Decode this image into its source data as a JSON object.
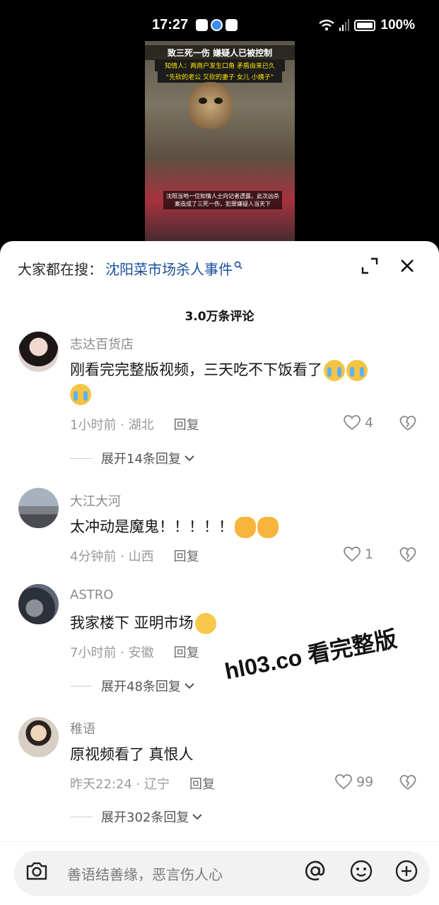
{
  "status_bar": {
    "time": "17:27",
    "battery": "100%"
  },
  "video": {
    "title": "致三死一伤 嫌疑人已被控制",
    "subtitle1": "知情人：两商户发生口角 矛盾由来已久",
    "subtitle2": "“先砍的老公 又砍的妻子 女儿 小姨子”",
    "caption": "沈阳当地一位知情人士向记者透露，此次凶杀案造成了三死一伤，犯罪嫌疑人当天下"
  },
  "header": {
    "search_prefix": "大家都在搜：",
    "search_term": "沈阳菜市场杀人事件",
    "comment_count": "3.0万条评论"
  },
  "comments": [
    {
      "user": "志达百货店",
      "text": "刚看完完整版视频，三天吃不下饭看了",
      "time_location": "1小时前 · 湖北",
      "reply": "回复",
      "likes": "4",
      "expand": "展开14条回复"
    },
    {
      "user": "大江大河",
      "text": "太冲动是魔鬼！！！！！",
      "time_location": "4分钟前 · 山西",
      "reply": "回复",
      "likes": "1"
    },
    {
      "user": "ASTRO",
      "text": "我家楼下 亚明市场",
      "time_location": "7小时前 · 安徽",
      "reply": "回复",
      "expand": "展开48条回复"
    },
    {
      "user": "稚语",
      "text": "原视频看了 真恨人",
      "time_location": "昨天22:24 · 辽宁",
      "reply": "回复",
      "likes": "99",
      "expand": "展开302条回复"
    }
  ],
  "watermark": "hl03.co 看完整版",
  "input": {
    "placeholder": "善语结善缘，恶言伤人心"
  },
  "icons": [
    "camera-icon",
    "at-icon",
    "emoji-icon",
    "add-icon",
    "expand-icon",
    "close-icon",
    "heart-icon",
    "dislike-icon",
    "chevron-down-icon",
    "search-icon"
  ]
}
